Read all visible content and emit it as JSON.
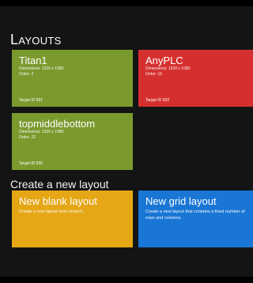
{
  "layouts": {
    "heading": "Layouts",
    "tiles": [
      {
        "name": "Titan1",
        "dimensions": "Dimensions: 1920 x 1080",
        "order": "Order: 3",
        "target": "Target ID 501",
        "color": "#7a9a2e"
      },
      {
        "name": "AnyPLC",
        "dimensions": "Dimensions: 1920 x 1080",
        "order": "Order: 15",
        "target": "Target ID 503",
        "color": "#d5302f"
      },
      {
        "name": "topmiddlebottom",
        "dimensions": "Dimensions: 1920 x 1080",
        "order": "Order: 22",
        "target": "Target ID 505",
        "color": "#7a9a2e"
      }
    ]
  },
  "create": {
    "heading": "Create a new layout",
    "blank": {
      "title": "New blank layout",
      "description": "Create a new layout from scratch.",
      "color": "#e5a716"
    },
    "grid": {
      "title": "New grid layout",
      "description": "Create a new layout that contains a fixed number of rows and columns.",
      "color": "#1976d5"
    }
  }
}
